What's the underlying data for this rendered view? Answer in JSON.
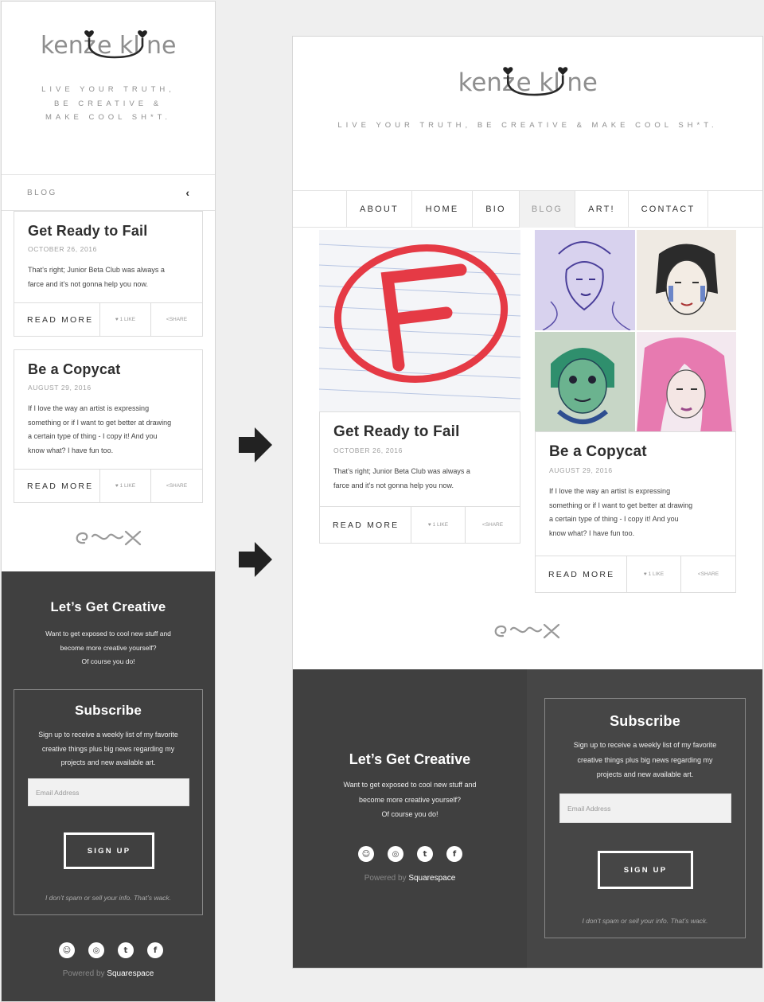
{
  "brand": {
    "name": "kenzie kline",
    "tagline": "LIVE YOUR TRUTH, BE CREATIVE & MAKE COOL SH*T.",
    "tagline_lines": [
      "LIVE YOUR TRUTH,",
      "BE CREATIVE &",
      "MAKE COOL SH*T."
    ]
  },
  "mobile_nav": {
    "label": "BLOG",
    "toggle_icon": "chevron-left-icon"
  },
  "nav": {
    "items": [
      {
        "label": "ABOUT"
      },
      {
        "label": "HOME"
      },
      {
        "label": "BIO"
      },
      {
        "label": "BLOG",
        "active": true
      },
      {
        "label": "ART!"
      },
      {
        "label": "CONTACT"
      }
    ]
  },
  "posts": [
    {
      "title": "Get Ready to Fail",
      "date": "OCTOBER 26, 2016",
      "excerpt": "That’s right; Junior Beta Club was always a farce and it’s not gonna help you now.",
      "excerpt_lines": [
        "That’s right; Junior Beta Club was always a",
        "farce and it’s not gonna help you now."
      ],
      "read_more": "READ MORE",
      "likes": "1 LIKE",
      "share": "SHARE"
    },
    {
      "title": "Be a Copycat",
      "date": "AUGUST 29, 2016",
      "excerpt": "If I love the way an artist is expressing something or if I want to get better at drawing a certain type of thing - I copy it! And you know what? I have fun too.",
      "excerpt_lines": [
        "If I love the way an artist is expressing",
        "something or if I want to get better at drawing",
        "a certain type of thing - I copy it! And you",
        "know what? I have fun too."
      ],
      "read_more": "READ MORE",
      "likes": "1 LIKE",
      "share": "SHARE"
    }
  ],
  "footer": {
    "heading": "Let’s Get Creative",
    "intro_lines": [
      "Want to get exposed to cool new stuff and",
      "become more creative yourself?",
      "Of course you do!"
    ],
    "subscribe": {
      "heading": "Subscribe",
      "desc_lines": [
        "Sign up to receive a weekly list of my favorite",
        "creative things plus big news regarding my",
        "projects and new available art."
      ],
      "email_placeholder": "Email Address",
      "button": "SIGN UP",
      "note": "I don’t spam or sell your info. That’s wack."
    },
    "socials": [
      {
        "icon": "snapchat-icon",
        "glyph": "☺"
      },
      {
        "icon": "instagram-icon",
        "glyph": "◎"
      },
      {
        "icon": "tumblr-icon",
        "glyph": "t"
      },
      {
        "icon": "facebook-icon",
        "glyph": "f"
      }
    ],
    "powered_prefix": "Powered by",
    "powered_brand": "Squarespace"
  },
  "colors": {
    "footer_bg": "#404040",
    "accent_red": "#e53a45",
    "text_dark": "#2e2e2e",
    "muted": "#8f8f8f"
  }
}
